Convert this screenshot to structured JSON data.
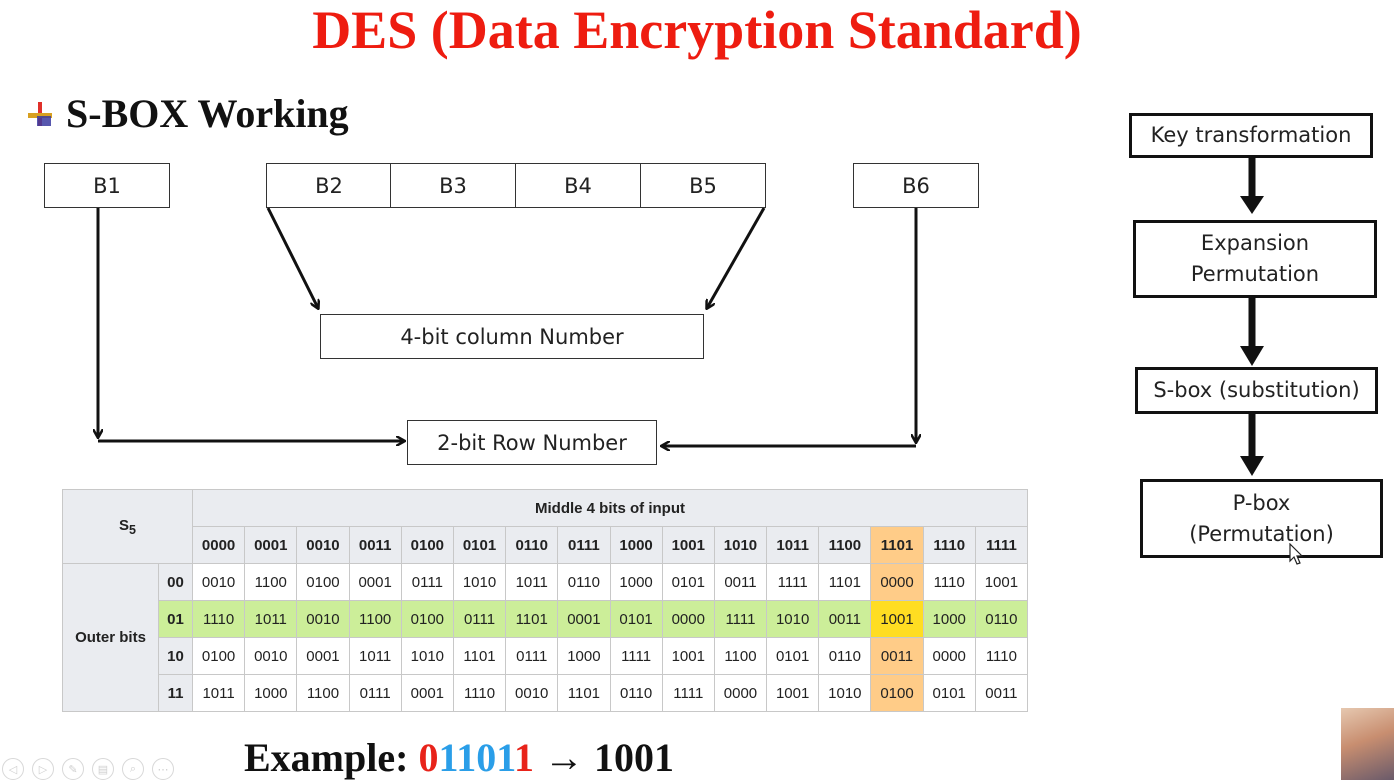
{
  "title": "DES (Data Encryption Standard)",
  "subtitle": "S-BOX Working",
  "bit_boxes": {
    "b1": "B1",
    "b2": "B2",
    "b3": "B3",
    "b4": "B4",
    "b5": "B5",
    "b6": "B6"
  },
  "column_box": "4-bit column Number",
  "row_box": "2-bit Row Number",
  "flow": {
    "step1": "Key transformation",
    "step2_line1": "Expansion",
    "step2_line2": "Permutation",
    "step3": "S-box (substitution)",
    "step4_line1": "P-box",
    "step4_line2": "(Permutation)"
  },
  "sbox_table": {
    "corner_label": "S",
    "corner_sub": "5",
    "middle_header": "Middle 4 bits of input",
    "outer_label": "Outer bits",
    "columns": [
      "0000",
      "0001",
      "0010",
      "0011",
      "0100",
      "0101",
      "0110",
      "0111",
      "1000",
      "1001",
      "1010",
      "1011",
      "1100",
      "1101",
      "1110",
      "1111"
    ],
    "rows": [
      {
        "label": "00",
        "values": [
          "0010",
          "1100",
          "0100",
          "0001",
          "0111",
          "1010",
          "1011",
          "0110",
          "1000",
          "0101",
          "0011",
          "1111",
          "1101",
          "0000",
          "1110",
          "1001"
        ]
      },
      {
        "label": "01",
        "values": [
          "1110",
          "1011",
          "0010",
          "1100",
          "0100",
          "0111",
          "1101",
          "0001",
          "0101",
          "0000",
          "1111",
          "1010",
          "0011",
          "1001",
          "1000",
          "0110"
        ]
      },
      {
        "label": "10",
        "values": [
          "0100",
          "0010",
          "0001",
          "1011",
          "1010",
          "1101",
          "0111",
          "1000",
          "1111",
          "1001",
          "1100",
          "0101",
          "0110",
          "0011",
          "0000",
          "1110"
        ]
      },
      {
        "label": "11",
        "values": [
          "1011",
          "1000",
          "1100",
          "0111",
          "0001",
          "1110",
          "0010",
          "1101",
          "0110",
          "1111",
          "0000",
          "1001",
          "1010",
          "0100",
          "0101",
          "0011"
        ]
      }
    ],
    "highlight_row": "01",
    "highlight_column": "1101",
    "colors": {
      "header_bg": "#eaecf0",
      "row_highlight": "#ccee99",
      "column_highlight": "#ffcc88",
      "cell_highlight": "#ffdd22"
    }
  },
  "example": {
    "prefix": "Example:",
    "bits_first": "0",
    "bits_middle": "1101",
    "bits_last": "1",
    "arrow": "→",
    "result": "1001"
  },
  "colors": {
    "title": "#ee1c10",
    "bit_outer": "#e8231a",
    "bit_middle": "#2a9ee8"
  },
  "toolbar_icons": [
    "previous-icon",
    "play-icon",
    "pen-icon",
    "slides-icon",
    "zoom-icon",
    "more-icon"
  ]
}
